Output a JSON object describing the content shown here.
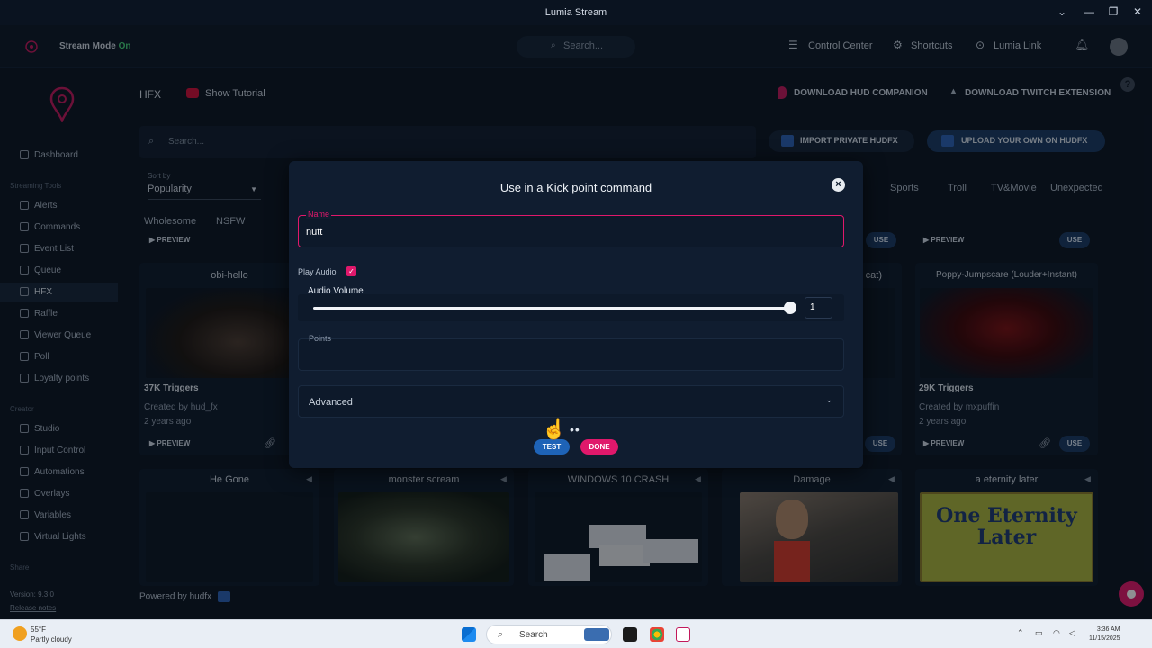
{
  "window": {
    "title": "Lumia Stream"
  },
  "topbar": {
    "stream_mode_label": "Stream Mode",
    "stream_mode_state": "On",
    "search_placeholder": "Search...",
    "control_center": "Control Center",
    "shortcuts": "Shortcuts",
    "lumia_link": "Lumia Link"
  },
  "sidebar": {
    "items_top": [
      {
        "label": "Dashboard"
      }
    ],
    "section_streaming": "Streaming Tools",
    "streaming_items": [
      {
        "label": "Alerts"
      },
      {
        "label": "Commands"
      },
      {
        "label": "Event List"
      },
      {
        "label": "Queue"
      },
      {
        "label": "HFX"
      },
      {
        "label": "Raffle"
      },
      {
        "label": "Viewer Queue"
      },
      {
        "label": "Poll"
      },
      {
        "label": "Loyalty points"
      }
    ],
    "section_creator": "Creator",
    "creator_items": [
      {
        "label": "Studio"
      },
      {
        "label": "Input Control"
      },
      {
        "label": "Automations"
      },
      {
        "label": "Overlays"
      },
      {
        "label": "Variables"
      },
      {
        "label": "Virtual Lights"
      }
    ],
    "section_share": "Share",
    "version": "Version: 9.3.0",
    "release_notes": "Release notes"
  },
  "main": {
    "title": "HFX",
    "show_tutorial": "Show Tutorial",
    "download_hud": "DOWNLOAD HUD COMPANION",
    "download_twitch": "DOWNLOAD TWITCH EXTENSION",
    "search_placeholder": "Search...",
    "import_private": "IMPORT PRIVATE HUDFX",
    "upload_own": "UPLOAD YOUR OWN ON HUDFX",
    "sort_by_label": "Sort by",
    "sort_by_value": "Popularity",
    "categories_left": [
      "Wholesome",
      "NSFW"
    ],
    "categories_right": [
      "Sports",
      "Troll",
      "TV&Movie",
      "Unexpected"
    ],
    "preview_label": "PREVIEW",
    "use_label": "USE",
    "cards_row1": [
      {
        "title": "obi-hello",
        "triggers": "37K Triggers",
        "creator": "Created by hud_fx",
        "age": "2 years ago"
      },
      {
        "title": "cat)",
        "triggers": "",
        "creator": "",
        "age": ""
      },
      {
        "title": "Poppy-Jumpscare (Louder+Instant)",
        "triggers": "29K Triggers",
        "creator": "Created by mxpuffin",
        "age": "2 years ago"
      }
    ],
    "cards_row2": [
      {
        "title": "He Gone"
      },
      {
        "title": "monster scream"
      },
      {
        "title": "WINDOWS 10 CRASH"
      },
      {
        "title": "Damage"
      },
      {
        "title": "a eternity later"
      }
    ],
    "eternity_text": "One Eternity Later",
    "powered_by": "Powered by hudfx"
  },
  "modal": {
    "title": "Use in a Kick point command",
    "name_label": "Name",
    "name_value": "nutt",
    "play_audio_label": "Play Audio",
    "play_audio_checked": true,
    "audio_volume_label": "Audio Volume",
    "audio_volume_value": "1",
    "points_label": "Points",
    "advanced_label": "Advanced",
    "test_label": "TEST",
    "done_label": "DONE"
  },
  "taskbar": {
    "weather_temp": "55°F",
    "weather_desc": "Partly cloudy",
    "search_label": "Search",
    "time": "3:36 AM",
    "date": "11/15/2025"
  },
  "colors": {
    "accent_pink": "#e0186b",
    "accent_blue": "#1e63b7",
    "bg": "#0b1422"
  }
}
